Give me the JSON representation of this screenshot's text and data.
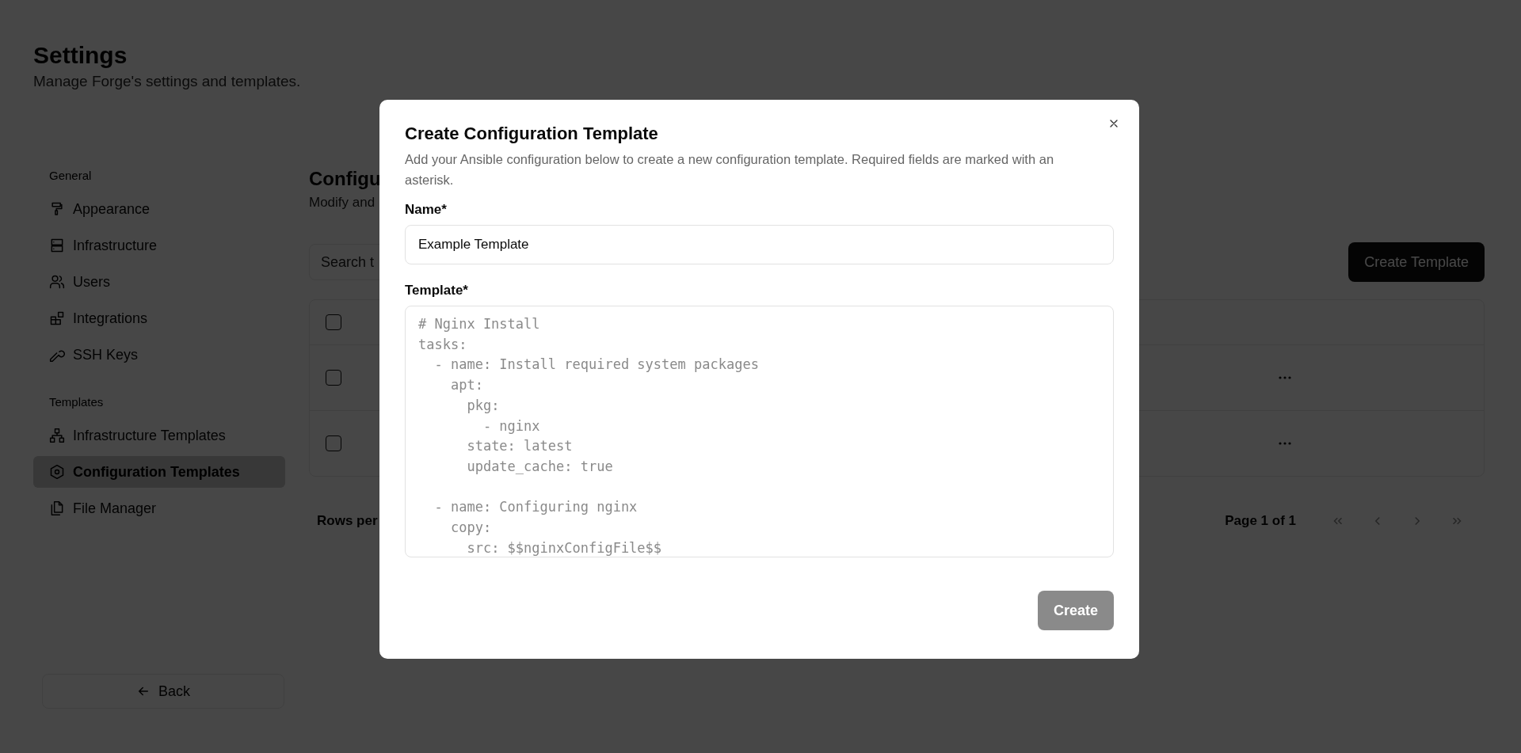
{
  "page": {
    "title": "Settings",
    "subtitle": "Manage Forge's settings and templates."
  },
  "sidebar": {
    "groups": [
      {
        "label": "General",
        "items": [
          {
            "label": "Appearance",
            "selected": false
          },
          {
            "label": "Infrastructure",
            "selected": false
          },
          {
            "label": "Users",
            "selected": false
          },
          {
            "label": "Integrations",
            "selected": false
          },
          {
            "label": "SSH Keys",
            "selected": false
          }
        ]
      },
      {
        "label": "Templates",
        "items": [
          {
            "label": "Infrastructure Templates",
            "selected": false
          },
          {
            "label": "Configuration Templates",
            "selected": true
          },
          {
            "label": "File Manager",
            "selected": false
          }
        ]
      }
    ],
    "back_button": "Back"
  },
  "main": {
    "title": "Configu",
    "subtitle": "Modify and",
    "search": {
      "placeholder": "Search t"
    },
    "create_button": "Create Template",
    "table": {
      "header": {
        "checked": false
      },
      "rows": [
        {
          "checked": false
        },
        {
          "checked": false
        }
      ]
    },
    "rows_per_page": "Rows per",
    "page_info": "Page 1 of 1"
  },
  "modal": {
    "title": "Create Configuration Template",
    "description": "Add your Ansible configuration below to create a new configuration template. Required fields are marked with an asterisk.",
    "name_label": "Name*",
    "name_value": "Example Template",
    "template_label": "Template*",
    "template_placeholder": "# Nginx Install\ntasks:\n  - name: Install required system packages\n    apt:\n      pkg:\n        - nginx\n      state: latest\n      update_cache: true\n\n  - name: Configuring nginx\n    copy:\n      src: $$nginxConfigFile$$",
    "create_button": {
      "label": "Create",
      "disabled": true
    }
  }
}
